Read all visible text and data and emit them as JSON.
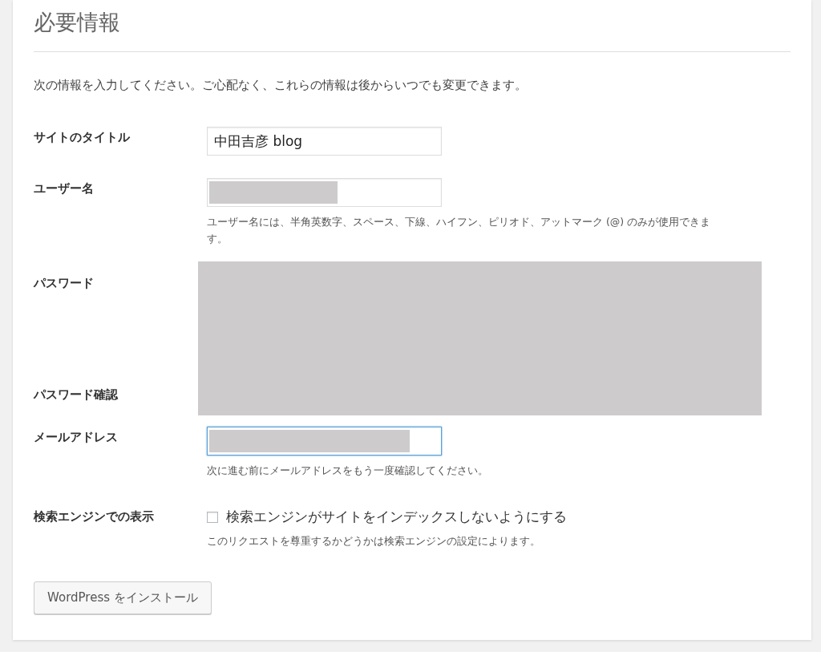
{
  "heading": "必要情報",
  "intro": "次の情報を入力してください。ご心配なく、これらの情報は後からいつでも変更できます。",
  "fields": [
    {
      "kind": "text",
      "label": "サイトのタイトル",
      "value": "中田吉彦 blog",
      "focused": false
    },
    {
      "kind": "redacted-text",
      "label": "ユーザー名",
      "focused": false,
      "hint": "ユーザー名には、半角英数字、スペース、下線、ハイフン、ピリオド、アットマーク (@) のみが使用できます。"
    },
    {
      "kind": "redacted-block",
      "labels": [
        "パスワード",
        "パスワード確認"
      ]
    },
    {
      "kind": "redacted-text",
      "label": "メールアドレス",
      "focused": true,
      "hint": "次に進む前にメールアドレスをもう一度確認してください。"
    },
    {
      "kind": "checkbox",
      "label": "検索エンジンでの表示",
      "option": "検索エンジンがサイトをインデックスしないようにする",
      "checked": false,
      "hint": "このリクエストを尊重するかどうかは検索エンジンの設定によります。"
    }
  ],
  "submit": "WordPress をインストール"
}
